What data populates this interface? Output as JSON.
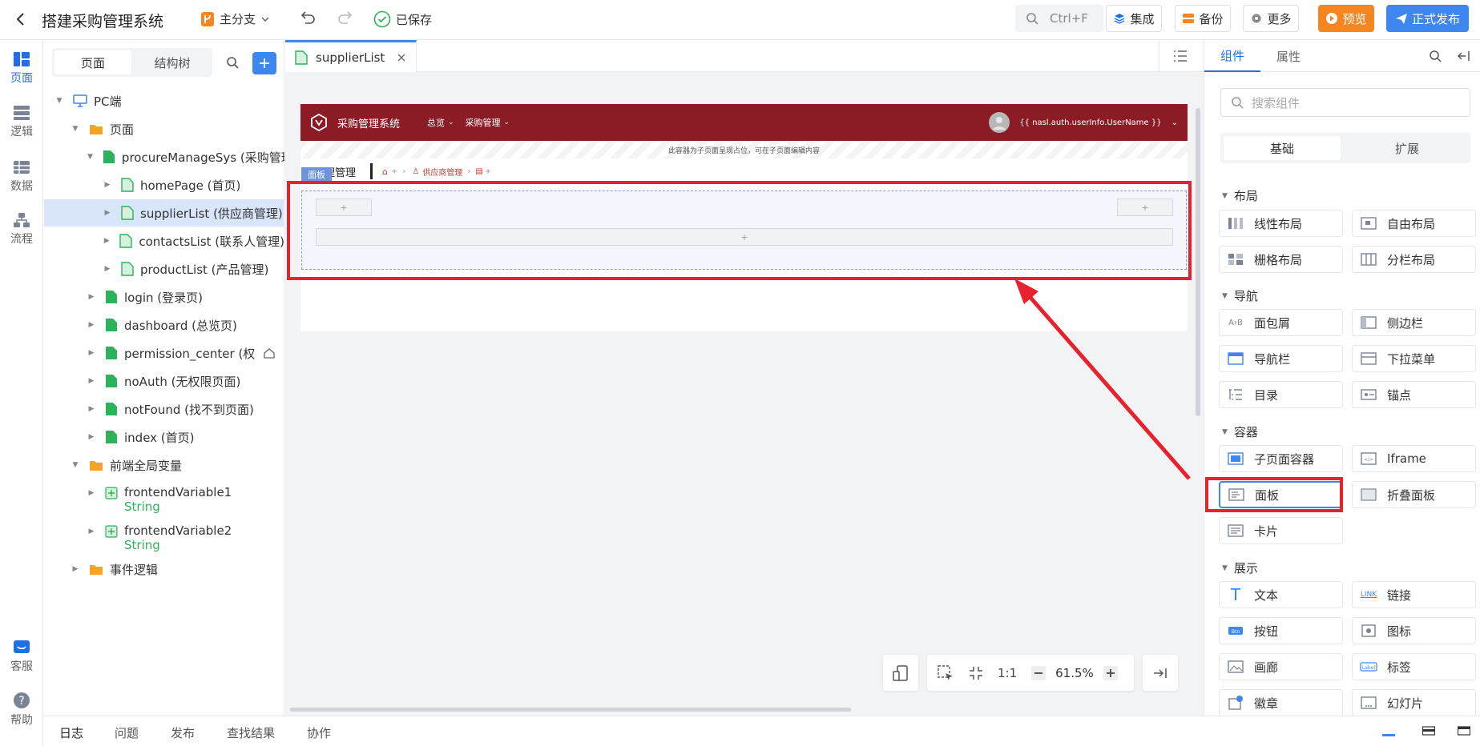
{
  "header": {
    "title": "搭建采购管理系统",
    "branch": "主分支",
    "saved": "已保存",
    "search_shortcut": "Ctrl+F",
    "integrate": "集成",
    "backup": "备份",
    "more": "更多",
    "preview": "预览",
    "publish": "正式发布"
  },
  "left_nav": {
    "items": [
      {
        "label": "页面"
      },
      {
        "label": "逻辑"
      },
      {
        "label": "数据"
      },
      {
        "label": "流程"
      },
      {
        "label": "客服"
      },
      {
        "label": "帮助"
      }
    ]
  },
  "tree_panel": {
    "tab_page": "页面",
    "tab_structure": "结构树",
    "nodes": {
      "pc": "PC端",
      "pages": "页面",
      "procure": "procureManageSys (采购管理",
      "home": "homePage (首页)",
      "supplier": "supplierList (供应商管理)",
      "contacts": "contactsList (联系人管理)",
      "product": "productList (产品管理)",
      "login": "login (登录页)",
      "dashboard": "dashboard (总览页)",
      "permission": "permission_center (权",
      "noauth": "noAuth (无权限页面)",
      "notfound": "notFound (找不到页面)",
      "index": "index (首页)",
      "globals": "前端全局变量",
      "fv1": "frontendVariable1",
      "fv1_type": "String",
      "fv2": "frontendVariable2",
      "fv2_type": "String",
      "events": "事件逻辑"
    }
  },
  "editor": {
    "tab_name": "supplierList",
    "preview": {
      "app_title": "采购管理系统",
      "menu_overview": "总览",
      "menu_procure": "采购管理",
      "user_expr": "{{ nasl.auth.userInfo.UserName }}",
      "placeholder_note": "此容器为子页面呈现占位，可在子页面编辑内容",
      "page_heading": "理管理",
      "panel_tag": "面板",
      "breadcrumb": "供应商管理",
      "plus": "+"
    },
    "zoom": "61.5%",
    "ratio": "1:1"
  },
  "right_panel": {
    "tab_components": "组件",
    "tab_properties": "属性",
    "search_placeholder": "搜索组件",
    "seg_basic": "基础",
    "seg_ext": "扩展",
    "categories": {
      "layout": "布局",
      "nav": "导航",
      "container": "容器",
      "display": "展示"
    },
    "components": {
      "linear": "线性布局",
      "free": "自由布局",
      "grid": "栅格布局",
      "split": "分栏布局",
      "breadcrumb": "面包屑",
      "sidebar": "侧边栏",
      "navbar": "导航栏",
      "dropdown": "下拉菜单",
      "toc": "目录",
      "anchor": "锚点",
      "subpage": "子页面容器",
      "iframe": "Iframe",
      "panel": "面板",
      "collapse": "折叠面板",
      "card": "卡片",
      "text": "文本",
      "link": "链接",
      "button": "按钮",
      "icon": "图标",
      "gallery": "画廊",
      "label": "标签",
      "badge": "徽章",
      "carousel": "幻灯片"
    }
  },
  "bottom_tabs": [
    "日志",
    "问题",
    "发布",
    "查找结果",
    "协作"
  ],
  "colors": {
    "primary": "#1f6fe5",
    "orange": "#f5861f",
    "header_red": "#8b1c25",
    "highlight_red": "#e8212f"
  }
}
